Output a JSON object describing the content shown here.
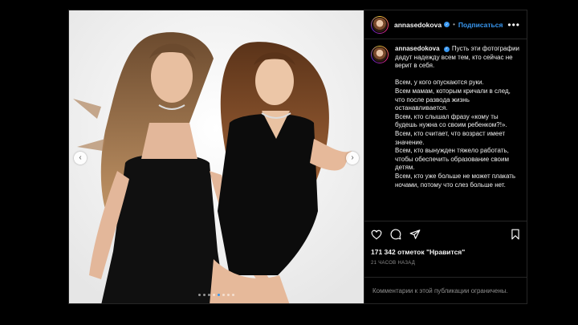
{
  "post": {
    "username": "annasedokova",
    "follow_label": "Подписаться",
    "separator": "•",
    "caption": "Пусть эти фотографии дадут надежду всем тем, кто сейчас не верит в себя.\n\nВсем, у кого опускаются руки.\nВсем мамам, которым кричали в след, что после развода жизнь останавливается.\nВсем, кто слышал фразу «кому ты будешь нужна со своим ребенком?!».\nВсем, кто считает, что возраст имеет значение.\nВсем, кто вынужден тяжело работать, чтобы обеспечить образование своим детям.\nВсем, кто уже больше не может плакать ночами, потому что слез больше нет.",
    "likes": "171 342 отметок \"Нравится\"",
    "time": "21 ЧАСОВ НАЗАД",
    "comments_disabled": "Комментарии к этой публикации ограничены."
  },
  "carousel": {
    "total": 8,
    "active": 4
  },
  "icons": {
    "verified": "verified-badge-icon",
    "more": "more-options-icon",
    "like": "heart-icon",
    "comment": "comment-icon",
    "share": "share-icon",
    "save": "bookmark-icon",
    "prev": "chevron-left-icon",
    "next": "chevron-right-icon"
  },
  "colors": {
    "accent": "#3897f0",
    "background": "#000000",
    "muted": "#8e8e8e"
  }
}
